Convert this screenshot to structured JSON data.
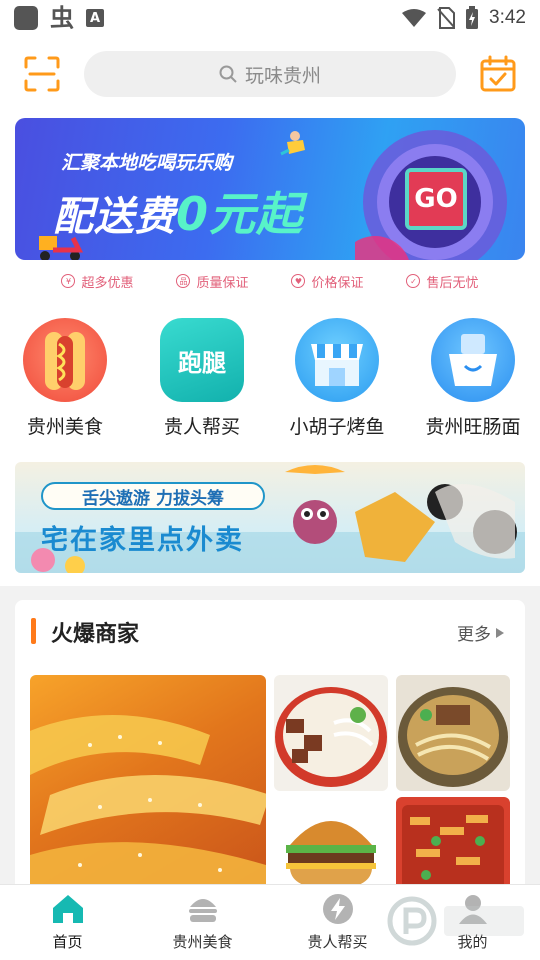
{
  "status_bar": {
    "time": "3:42",
    "left_glyph_bug": "虫",
    "left_glyph_a": "A"
  },
  "search": {
    "placeholder": "玩味贵州"
  },
  "banner": {
    "subtitle": "汇聚本地吃喝玩乐购",
    "title_prefix": "配送费",
    "title_highlight": "0元起",
    "go_label": "GO"
  },
  "guarantees": [
    {
      "label": "超多优惠",
      "icon": "yen-icon"
    },
    {
      "label": "质量保证",
      "icon": "quality-icon"
    },
    {
      "label": "价格保证",
      "icon": "heart-icon"
    },
    {
      "label": "售后无忧",
      "icon": "shield-icon"
    }
  ],
  "categories": [
    {
      "label": "贵州美食",
      "icon": "hotdog-icon"
    },
    {
      "label": "贵人帮买",
      "icon": "errand-icon",
      "icon_text": "跑腿"
    },
    {
      "label": "小胡子烤鱼",
      "icon": "store-icon"
    },
    {
      "label": "贵州旺肠面",
      "icon": "box-icon"
    }
  ],
  "promo": {
    "pill": "舌尖遨游 力拔头筹",
    "title": "宅在家里点外卖"
  },
  "section": {
    "title": "火爆商家",
    "more": "更多"
  },
  "bottom_nav": [
    {
      "label": "首页",
      "icon": "home-icon",
      "active": true
    },
    {
      "label": "贵州美食",
      "icon": "burger-icon",
      "active": false
    },
    {
      "label": "贵人帮买",
      "icon": "lightning-icon",
      "active": false
    },
    {
      "label": "我的",
      "icon": "user-icon",
      "active": false
    }
  ],
  "colors": {
    "accent": "#ff9a1a",
    "brand_teal": "#16b9b2",
    "section_bar": "#ff7a1a"
  }
}
